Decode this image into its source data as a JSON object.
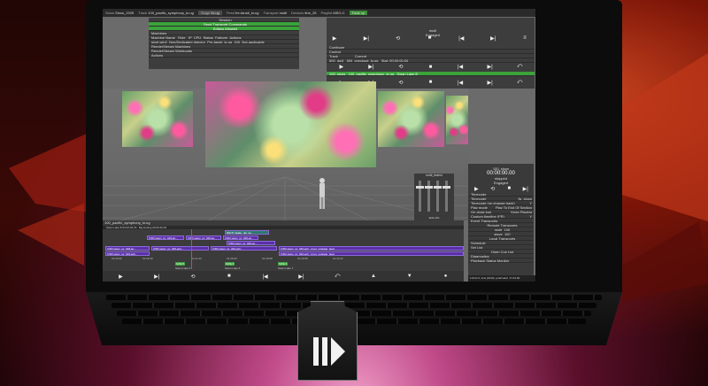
{
  "colors": {
    "accent_green": "#3aa33a",
    "clip_purple": "#5b2fa8",
    "background_red": "#7a1407"
  },
  "topbar": {
    "items": [
      {
        "label": "Show",
        "value": "Show_2025"
      },
      {
        "label": "Track",
        "value": "100_pacific_symphony_kr.ug"
      },
      {
        "label": "Stage",
        "value": "Kr.ug"
      },
      {
        "label": "Feed",
        "value": "fre-fanslt_kr.ug"
      },
      {
        "label": "Transport",
        "value": "multi"
      },
      {
        "label": "Devices",
        "value": "fine_25"
      },
      {
        "label": "Playlist",
        "value": "MSG-C"
      },
      {
        "label": "Fade",
        "value": "Fade up"
      }
    ]
  },
  "machines_panel": {
    "title": "Session",
    "send_label": "Send Transport Commands",
    "editors_label": "Editors Allowed",
    "section": "Machines",
    "columns": [
      "Machine Name",
      "Role",
      "IP",
      "CPU",
      "Status",
      "Failover",
      "Actions"
    ],
    "row": [
      "pixel-win2",
      "Non/Dedicated director",
      "Pre-fanslt_kr.ug",
      "100",
      "",
      "",
      "Not applicable"
    ],
    "sections": [
      "RenderStream Machines",
      "RenderStream Workloads",
      "Actions"
    ]
  },
  "transport_panel": {
    "name": "multi",
    "state": "Engaged",
    "configure": "Configure",
    "control": "Control",
    "track_label": "Track",
    "current_label": "Current",
    "track_rows": [
      {
        "id": "500_dw3",
        "name": "500_checkout_kr.ug",
        "status": "Stat: 00:00:00:00"
      },
      {
        "id": "100_show",
        "name": "100_pacific_symphony_kr.ug",
        "status": "Swan Lake B"
      }
    ]
  },
  "track_title": "100_pacific_symphony_kr.ug",
  "timeline": {
    "header": "Swan Lake B  00:00:02:26",
    "info": "Big Ending  00:06:26:33",
    "timecodes": [
      "01:00:00",
      "01:06:30",
      "01:21:23",
      "01:36:00",
      "01:40:58",
      "01:40:58",
      "01:41:02"
    ],
    "clips_top": [
      {
        "label": "[VID] swan_ux_019-ac..."
      },
      {
        "label": "[VID] swan_ux_025-ac..."
      },
      {
        "label": "[VID] swan_ux_026-ac..."
      },
      {
        "label": "[VID] swan_ux_040-ac..."
      },
      {
        "label": "[MCT] Intake_ulti_pa"
      }
    ],
    "clips_bottom": [
      {
        "label": "[VID] swan_ux_018-ac..."
      },
      {
        "label": "[VID] swan_ux_019-acti..."
      },
      {
        "label": "[VID] swan_ux_025-acti..."
      },
      {
        "label": "[VID] swan_ux_040-acti..."
      },
      {
        "label": "[VID] swan_ux_040-acti - kr.ug_upstage_feed"
      }
    ],
    "markers": [
      "SWE 5",
      "SWE 6",
      "Swan Lake 5",
      "Swan Lake 6",
      "Swan Lake 7"
    ]
  },
  "stage": {
    "fader_label": "multi_faders",
    "fade_label": "fade N/A"
  },
  "show_panel": {
    "title": "100_show",
    "timecode": "00:00:00.00",
    "status": "stopped",
    "engaged": "Engaged",
    "timecode_label": "Timecode",
    "rows": [
      {
        "label": "Timecode",
        "value": "3s_show"
      },
      {
        "label": "Timecode (on change track)",
        "value": "Y"
      },
      {
        "label": "Play mode",
        "value": "Play To End Of Section"
      },
      {
        "label": "On clock lost",
        "value": "Keep Playing"
      },
      {
        "label": "Custom timeline (FR)",
        "value": "Y"
      }
    ],
    "event_transports": "Event Transports",
    "remote_transports": "Remote Transports",
    "remote_items": [
      "multi_100",
      "slave_100"
    ],
    "local_transports": "Local Transports",
    "schedule": "Schedule",
    "set_list": "Set List",
    "open_cue_list": "Open Cue List",
    "diagnostics": "Diagnostics",
    "playback_status": "Playback Status Monitor"
  },
  "statusbar": {
    "left": "1:01:0.3, 1ms (2210)",
    "mid": "joreF.win2",
    "time": "17:41:32"
  }
}
